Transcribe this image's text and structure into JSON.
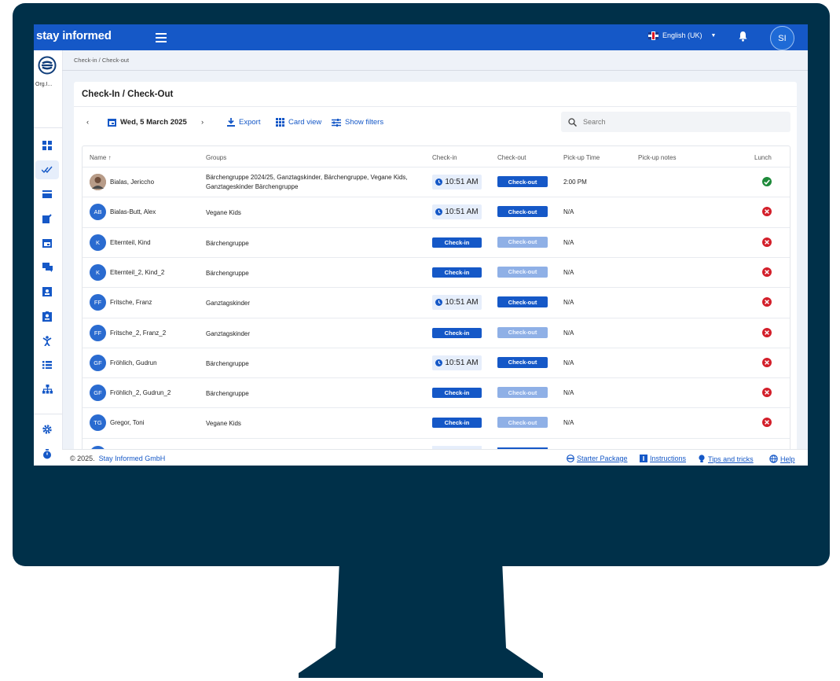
{
  "header": {
    "brand": "stay informed",
    "language": "English (UK)",
    "user_initials": "SI"
  },
  "sidebar": {
    "org": "Org.I...",
    "items": [
      "dashboard-icon",
      "checkin-icon",
      "news-icon",
      "edit-icon",
      "calendar-icon",
      "chat-icon",
      "contact-card-icon",
      "id-card-icon",
      "child-icon",
      "list-icon",
      "org-chart-icon",
      "settings-icon",
      "timer-icon",
      "dark-mode-icon"
    ]
  },
  "breadcrumb": "Check-in / Check-out",
  "page": {
    "title": "Check-In / Check-Out",
    "date": "Wed, 5 March 2025",
    "export_label": "Export",
    "card_view_label": "Card view",
    "show_filters_label": "Show filters",
    "search_placeholder": "Search"
  },
  "table": {
    "columns": [
      "Name ↑",
      "Groups",
      "Check-in",
      "Check-out",
      "Pick-up Time",
      "Pick-up notes",
      "Lunch"
    ],
    "rows": [
      {
        "initials": "",
        "photo": true,
        "name": "Bialas, Jericcho",
        "groups": "Bärchengruppe 2024/25, Ganztagskinder, Bärchengruppe, Vegane Kids, Ganztageskinder Bärchengruppe",
        "checkin": "10:51 AM",
        "checkout": "Check-out",
        "checkout_enabled": true,
        "pickup": "2:00 PM",
        "lunch": true
      },
      {
        "initials": "AB",
        "photo": false,
        "name": "Bialas-Butt, Alex",
        "groups": "Vegane Kids",
        "checkin": "10:51 AM",
        "checkout": "Check-out",
        "checkout_enabled": true,
        "pickup": "N/A",
        "lunch": false
      },
      {
        "initials": "K",
        "photo": false,
        "name": "Elternteil, Kind",
        "groups": "Bärchengruppe",
        "checkin": "Check-in",
        "checkout": "Check-out",
        "checkout_enabled": false,
        "pickup": "N/A",
        "lunch": false
      },
      {
        "initials": "K",
        "photo": false,
        "name": "Elternteil_2, Kind_2",
        "groups": "Bärchengruppe",
        "checkin": "Check-in",
        "checkout": "Check-out",
        "checkout_enabled": false,
        "pickup": "N/A",
        "lunch": false
      },
      {
        "initials": "FF",
        "photo": false,
        "name": "Fritsche, Franz",
        "groups": "Ganztagskinder",
        "checkin": "10:51 AM",
        "checkout": "Check-out",
        "checkout_enabled": true,
        "pickup": "N/A",
        "lunch": false
      },
      {
        "initials": "FF",
        "photo": false,
        "name": "Fritsche_2, Franz_2",
        "groups": "Ganztagskinder",
        "checkin": "Check-in",
        "checkout": "Check-out",
        "checkout_enabled": false,
        "pickup": "N/A",
        "lunch": false
      },
      {
        "initials": "GF",
        "photo": false,
        "name": "Fröhlich, Gudrun",
        "groups": "Bärchengruppe",
        "checkin": "10:51 AM",
        "checkout": "Check-out",
        "checkout_enabled": true,
        "pickup": "N/A",
        "lunch": false
      },
      {
        "initials": "GF",
        "photo": false,
        "name": "Fröhlich_2, Gudrun_2",
        "groups": "Bärchengruppe",
        "checkin": "Check-in",
        "checkout": "Check-out",
        "checkout_enabled": false,
        "pickup": "N/A",
        "lunch": false
      },
      {
        "initials": "TG",
        "photo": false,
        "name": "Gregor, Toni",
        "groups": "Vegane Kids",
        "checkin": "Check-in",
        "checkout": "Check-out",
        "checkout_enabled": false,
        "pickup": "N/A",
        "lunch": false
      }
    ]
  },
  "footer": {
    "copyright": "© 2025.",
    "company": "Stay Informed GmbH",
    "links": [
      "Starter Package",
      "Instructions",
      "Tips and tricks",
      "Help"
    ]
  },
  "colors": {
    "brand": "#1558c7",
    "monitor": "#003049",
    "ok": "#1e8a3a",
    "error": "#d31f2a"
  }
}
